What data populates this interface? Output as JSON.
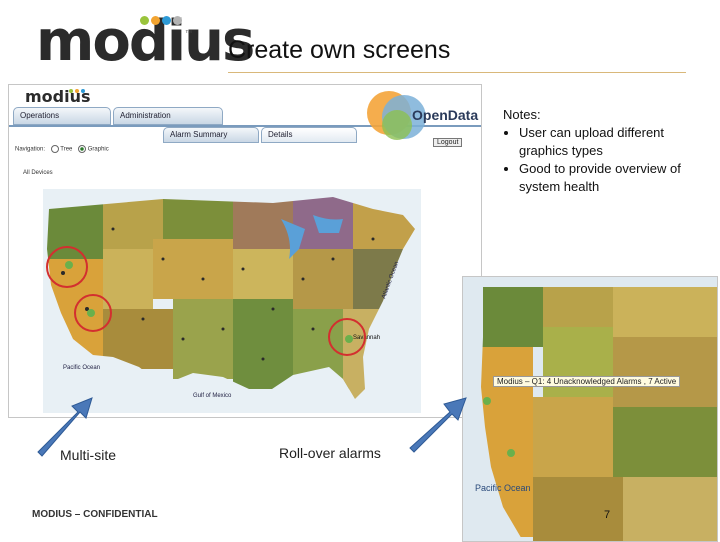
{
  "slide": {
    "title": "Create own screens",
    "logo_text": "modius",
    "logo_tm": "™",
    "notes_heading": "Notes:",
    "notes": [
      "User can upload different graphics types",
      "Good to provide overview of system health"
    ],
    "label_multisite": "Multi-site",
    "label_rollover": "Roll-over alarms",
    "footer": "MODIUS – CONFIDENTIAL",
    "page_number": "7"
  },
  "app": {
    "logo_text": "modius",
    "tabs": [
      "Operations",
      "Administration"
    ],
    "subtabs": [
      "Alarm Summary",
      "Details"
    ],
    "nav_label": "Navigation:",
    "nav_options": [
      "Tree",
      "Graphic"
    ],
    "all_devices": "All Devices",
    "opendata_logo": "OpenData",
    "logout": "Logout",
    "map_labels": {
      "gulf": "Gulf of Mexico",
      "pacific": "Pacific Ocean",
      "atlantic": "Atlantic Ocean",
      "savannah": "Savannah"
    }
  },
  "rollover": {
    "tooltip": "Modius – Q1: 4 Unacknowledged Alarms , 7 Active",
    "pacific": "Pacific Ocean"
  },
  "colors": {
    "accent_rule": "#d9b87a",
    "arrow": "#4a78b8",
    "circle": "#d32f2f",
    "dots": [
      "#9ac43c",
      "#f2a431",
      "#2d9ad6",
      "#b3b3b3"
    ]
  }
}
